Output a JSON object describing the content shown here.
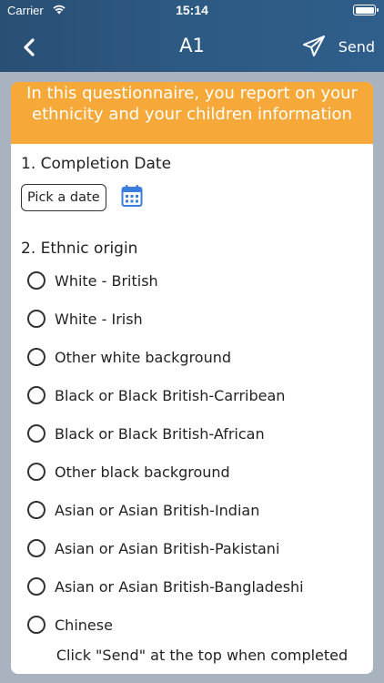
{
  "status_bar": {
    "carrier": "Carrier",
    "time": "15:14"
  },
  "nav": {
    "title": "A1",
    "send_label": "Send"
  },
  "banner": {
    "text": "In this questionnaire, you report on your ethnicity and your children information"
  },
  "section1": {
    "title": "1. Completion Date",
    "date_button": "Pick a date"
  },
  "section2": {
    "title": "2. Ethnic origin",
    "options": [
      "White - British",
      "White - Irish",
      "Other white background",
      "Black or Black British-Carribean",
      "Black or Black British-African",
      "Other black background",
      "Asian or Asian British-Indian",
      "Asian or Asian British-Pakistani",
      "Asian or Asian British-Bangladeshi",
      "Chinese"
    ]
  },
  "footer": {
    "text": "Click \"Send\" at the top when completed"
  },
  "colors": {
    "header": "#2d5a83",
    "banner": "#f6a938",
    "calendar_icon": "#3b7ddd"
  }
}
